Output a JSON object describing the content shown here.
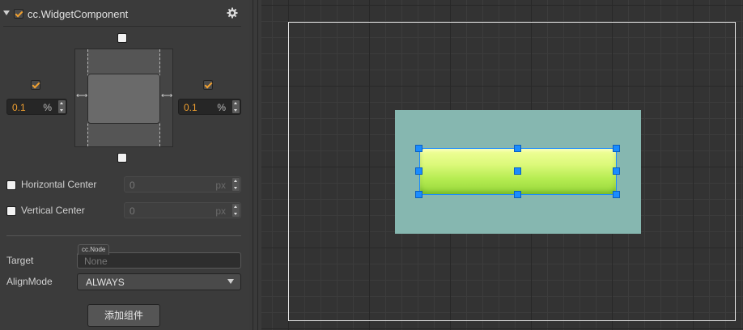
{
  "component": {
    "title": "cc.WidgetComponent",
    "enabled": true,
    "settings_icon": "gear-icon",
    "collapse_icon": "triangle-down-icon"
  },
  "widget": {
    "top_checked": false,
    "bottom_checked": false,
    "left": {
      "checked": true,
      "value": "0.1",
      "unit": "%"
    },
    "right": {
      "checked": true,
      "value": "0.1",
      "unit": "%"
    },
    "horizontal_center": {
      "label": "Horizontal Center",
      "checked": false,
      "value": "0",
      "unit": "px"
    },
    "vertical_center": {
      "label": "Vertical Center",
      "checked": false,
      "value": "0",
      "unit": "px"
    }
  },
  "target": {
    "label": "Target",
    "type_tag": "cc.Node",
    "value": "None"
  },
  "align_mode": {
    "label": "AlignMode",
    "value": "ALWAYS"
  },
  "add_component_label": "添加组件",
  "colors": {
    "accent": "#f0a030",
    "selection": "#1a8cff",
    "parent_node": "#86b7b0",
    "button_green": "#a8e04a"
  }
}
